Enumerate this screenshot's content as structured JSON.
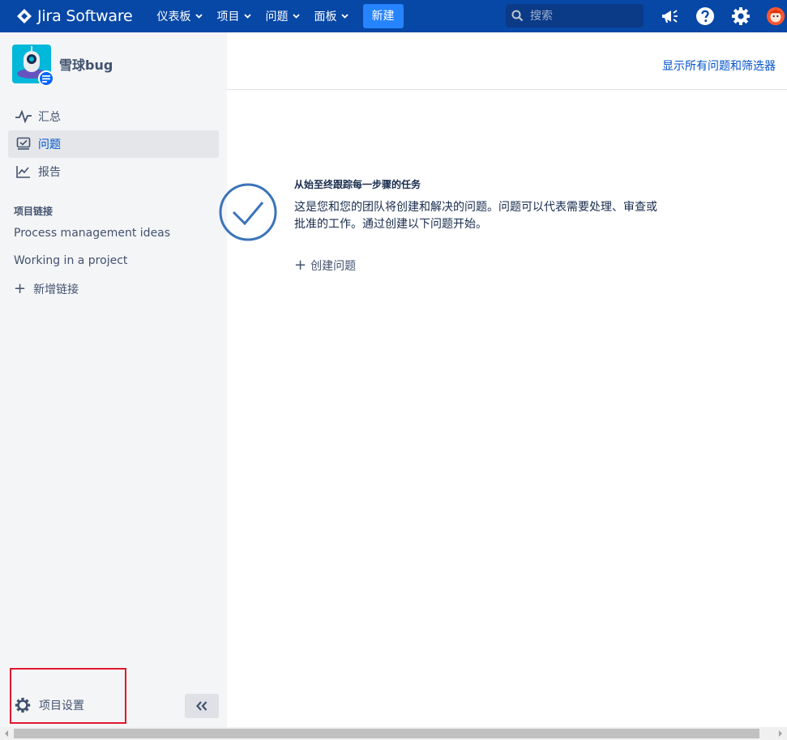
{
  "topbar": {
    "brand": "Jira Software",
    "nav": [
      {
        "label": "仪表板"
      },
      {
        "label": "项目"
      },
      {
        "label": "问题"
      },
      {
        "label": "面板"
      }
    ],
    "create_label": "新建",
    "search_placeholder": "搜索",
    "icons": [
      "megaphone-icon",
      "help-icon",
      "settings-icon",
      "user-avatar"
    ]
  },
  "sidebar": {
    "project_name": "雪球bug",
    "items": [
      {
        "label": "汇总",
        "icon": "pulse-icon"
      },
      {
        "label": "问题",
        "icon": "issues-icon",
        "active": true
      },
      {
        "label": "报告",
        "icon": "chart-icon"
      }
    ],
    "links_title": "项目链接",
    "links": [
      {
        "label": "Process management ideas"
      },
      {
        "label": "Working in a project"
      }
    ],
    "add_link_label": "新增链接",
    "settings_label": "项目设置"
  },
  "main": {
    "filters_link": "显示所有问题和筛选器",
    "empty_title": "从始至终跟踪每一步骤的任务",
    "empty_desc": "这是您和您的团队将创建和解决的问题。问题可以代表需要处理、审查或批准的工作。通过创建以下问题开始。",
    "create_issue_label": "创建问题"
  },
  "colors": {
    "topbar": "#0747a6",
    "create_button": "#2684ff",
    "sidebar": "#f4f5f7",
    "link": "#0052cc",
    "highlight": "#e0182d"
  }
}
